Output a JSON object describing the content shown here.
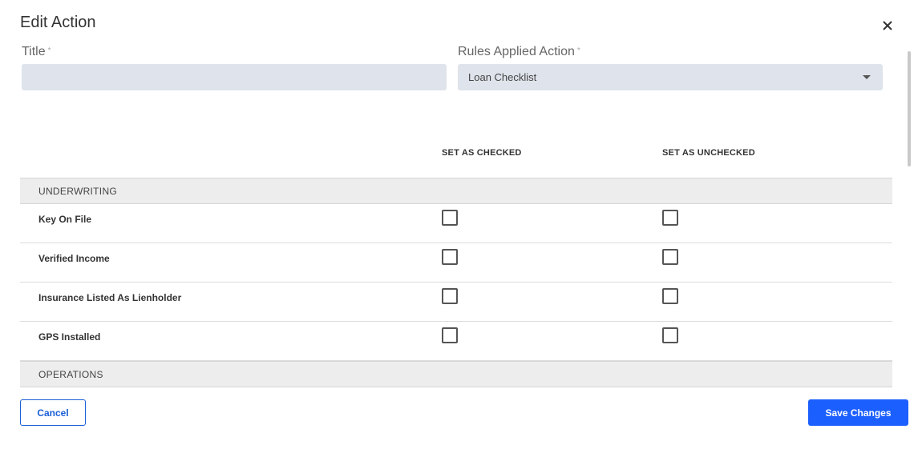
{
  "dialog": {
    "title": "Edit Action",
    "close_icon": "close-icon"
  },
  "form": {
    "title_label": "Title",
    "title_required": "*",
    "title_value": "",
    "rules_label": "Rules Applied Action",
    "rules_required": "*",
    "rules_value": "Loan Checklist",
    "dropdown_icon": "chevron-down-icon"
  },
  "table": {
    "col_checked": "SET AS CHECKED",
    "col_unchecked": "SET AS UNCHECKED",
    "sections": [
      {
        "name": "UNDERWRITING",
        "items": [
          {
            "label": "Key On File",
            "set_checked": false,
            "set_unchecked": false
          },
          {
            "label": "Verified Income",
            "set_checked": false,
            "set_unchecked": false
          },
          {
            "label": "Insurance Listed As Lienholder",
            "set_checked": false,
            "set_unchecked": false
          },
          {
            "label": "GPS Installed",
            "set_checked": false,
            "set_unchecked": false
          }
        ]
      },
      {
        "name": "OPERATIONS",
        "items": []
      }
    ]
  },
  "footer": {
    "cancel_label": "Cancel",
    "save_label": "Save Changes"
  },
  "colors": {
    "primary": "#1c5fff",
    "input_bg": "#dfe3eb",
    "section_bg": "#ededed"
  }
}
